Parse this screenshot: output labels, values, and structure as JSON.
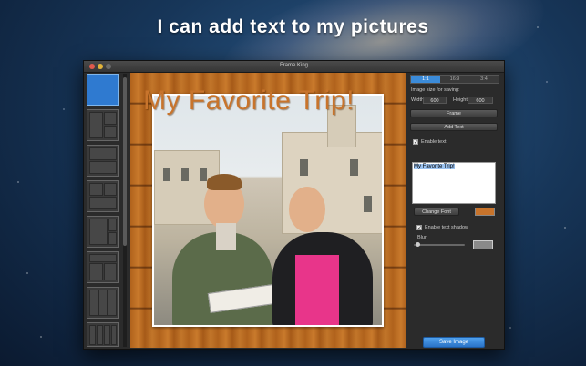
{
  "headline": "I can add text to my pictures",
  "window": {
    "title": "Frame King"
  },
  "canvas": {
    "overlay_text": "My Favorite Trip!",
    "frame_style": "wood-planks"
  },
  "panel": {
    "ratios": [
      "1:1",
      "16:9",
      "3:4"
    ],
    "selected_ratio": "1:1",
    "image_size_label": "Image size for saving:",
    "width_label": "Width",
    "width_value": "600",
    "height_label": "Height",
    "height_value": "600",
    "frame_button": "Frame",
    "add_text_button": "Add Text",
    "enable_text_label": "Enable text",
    "enable_text_checked": true,
    "text_value": "My Favorite Trip!",
    "change_font_button": "Change Font",
    "text_color": "#c8742c",
    "enable_shadow_label": "Enable text shadow",
    "enable_shadow_checked": true,
    "blur_label": "Blur:",
    "blur_value": 0.05,
    "shadow_color": "#8a8a8a",
    "save_button": "Save Image"
  },
  "colors": {
    "accent": "#3b8bd9",
    "selected_layout": "#2f7ad0"
  }
}
